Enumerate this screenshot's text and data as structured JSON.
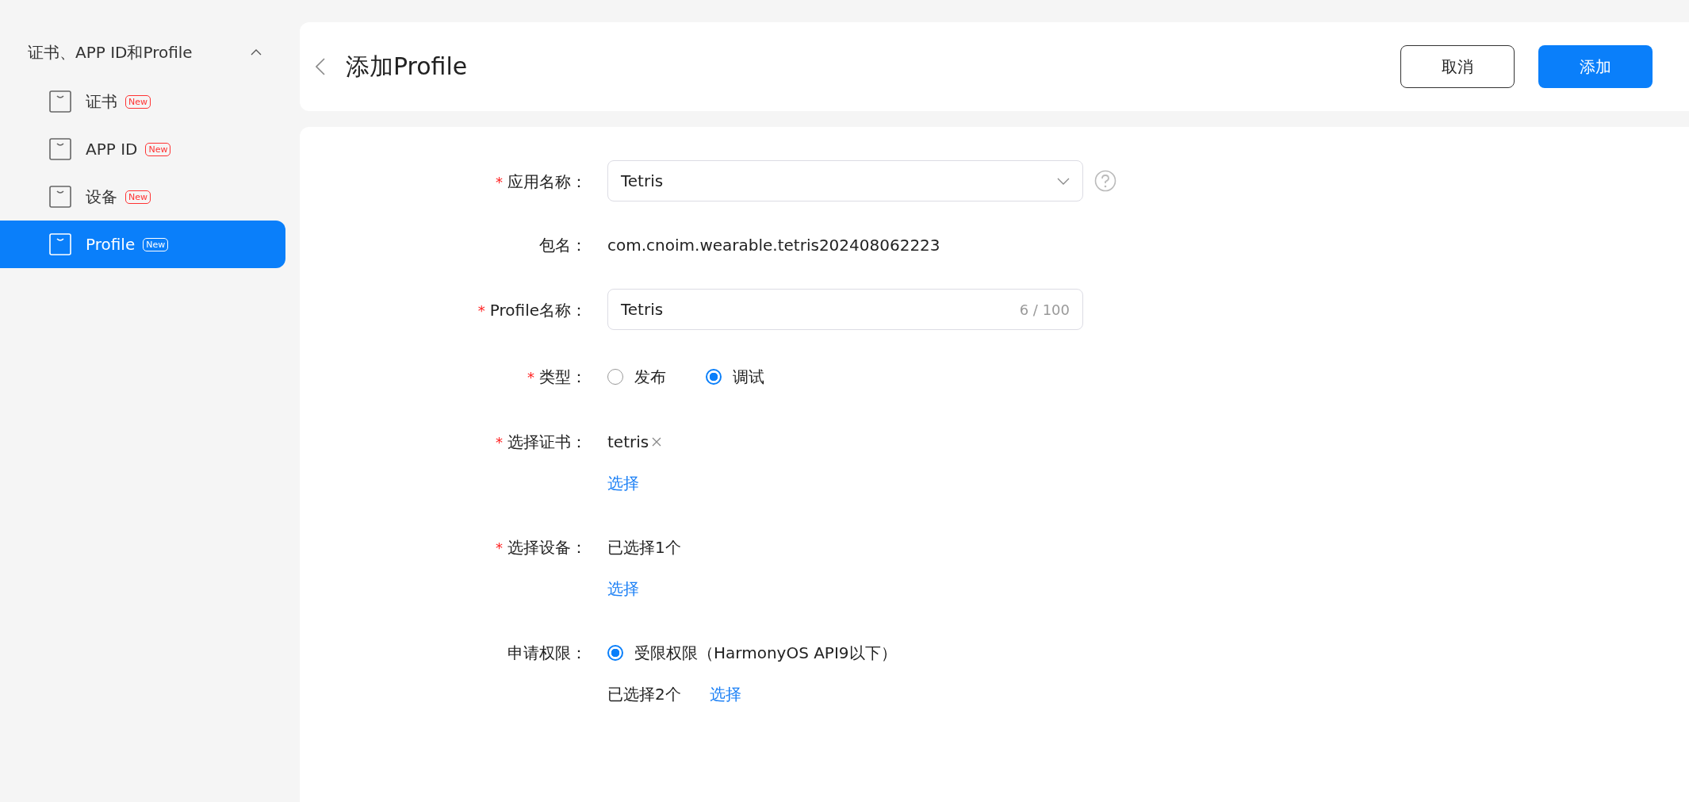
{
  "sidebar": {
    "group": {
      "label": "证书、APP ID和Profile",
      "expanded": true
    },
    "items": [
      {
        "label": "证书",
        "badge": "New",
        "selected": false
      },
      {
        "label": "APP ID",
        "badge": "New",
        "selected": false
      },
      {
        "label": "设备",
        "badge": "New",
        "selected": false
      },
      {
        "label": "Profile",
        "badge": "New",
        "selected": true
      }
    ]
  },
  "header": {
    "title": "添加Profile",
    "buttons": [
      {
        "label": "取消",
        "kind": "secondary"
      },
      {
        "label": "添加",
        "kind": "primary"
      }
    ]
  },
  "form": {
    "required_mark": "*",
    "fields": [
      {
        "kind": "select",
        "label": "应用名称：",
        "required": true,
        "value": "Tetris"
      },
      {
        "kind": "text",
        "label": "包名：",
        "required": false,
        "value": "com.cnoim.wearable.tetris202408062223"
      },
      {
        "kind": "input",
        "label": "Profile名称：",
        "required": true,
        "value": "Tetris",
        "counter": "6 / 100"
      },
      {
        "kind": "radio",
        "label": "类型：",
        "required": true,
        "options": [
          {
            "label": "发布",
            "selected": false
          },
          {
            "label": "调试",
            "selected": true
          }
        ]
      },
      {
        "kind": "tags",
        "label": "选择证书：",
        "required": true,
        "tags": [
          "tetris"
        ],
        "link": "选择"
      },
      {
        "kind": "summary",
        "label": "选择设备：",
        "required": true,
        "value": "已选择1个",
        "link": "选择"
      },
      {
        "kind": "permission",
        "label": "申请权限：",
        "required": false,
        "options": [
          {
            "label": "受限权限（HarmonyOS API9以下）",
            "selected": true
          }
        ],
        "value": "已选择2个",
        "link": "选择"
      }
    ]
  }
}
